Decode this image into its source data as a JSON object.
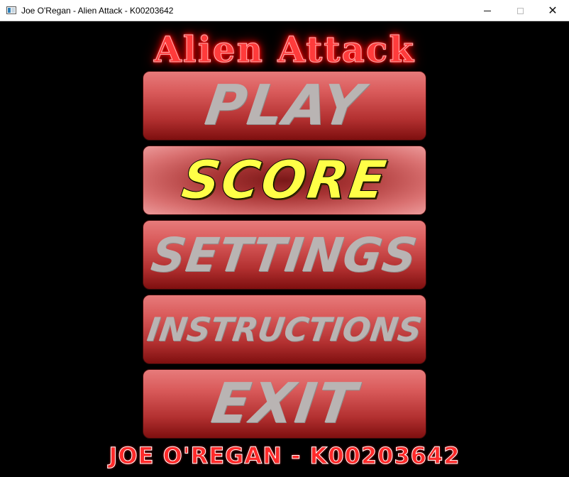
{
  "window": {
    "title": "Joe O'Regan - Alien Attack - K00203642",
    "icon": "app-window-icon",
    "controls": {
      "minimize": "minimize-icon",
      "maximize": "maximize-icon",
      "close": "close-icon"
    },
    "close_glyph": "✕"
  },
  "game": {
    "title": "Alien Attack",
    "menu": [
      {
        "id": "play",
        "label": "PLAY",
        "selected": false
      },
      {
        "id": "score",
        "label": "SCORE",
        "selected": true
      },
      {
        "id": "settings",
        "label": "SETTINGS",
        "selected": false
      },
      {
        "id": "instructions",
        "label": "INSTRUCTIONS",
        "selected": false
      },
      {
        "id": "exit",
        "label": "EXIT",
        "selected": false
      }
    ],
    "credits": "JOE O'REGAN - K00203642"
  },
  "colors": {
    "background": "#000000",
    "title": "#ff3b3b",
    "button_top": "#e77b7b",
    "button_bottom": "#7e0f0f",
    "label": "#b9b4b3",
    "label_selected": "#ffff47",
    "credits": "#ff2a2a"
  }
}
